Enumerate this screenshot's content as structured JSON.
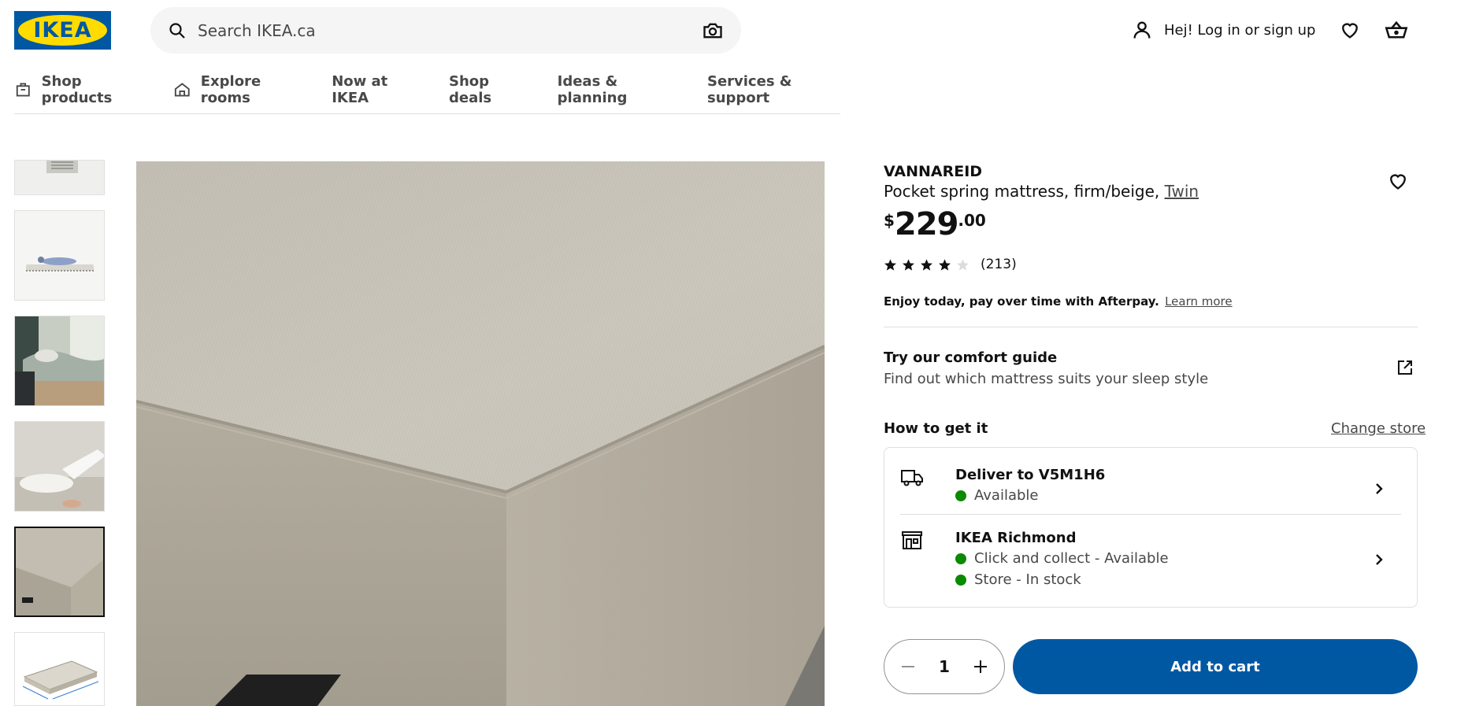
{
  "header": {
    "logo_text": "IKEA",
    "search_placeholder": "Search IKEA.ca",
    "login_label": "Hej! Log in or sign up"
  },
  "nav": {
    "items": [
      {
        "label": "Shop products",
        "icon": "store-bag-icon"
      },
      {
        "label": "Explore rooms",
        "icon": "house-icon"
      },
      {
        "label": "Now at IKEA"
      },
      {
        "label": "Shop deals"
      },
      {
        "label": "Ideas & planning"
      },
      {
        "label": "Services & support"
      }
    ]
  },
  "gallery": {
    "thumbnail_count": 6,
    "active_index": 4
  },
  "product": {
    "name": "VANNAREID",
    "description": "Pocket spring mattress, firm/beige,",
    "size_link": "Twin",
    "price_currency": "$",
    "price_integer": "229",
    "price_decimal": ".00",
    "rating_value": 4,
    "rating_max": 5,
    "review_count": "(213)",
    "afterpay_text": "Enjoy today, pay over time with Afterpay.",
    "afterpay_link": "Learn more"
  },
  "comfort": {
    "title": "Try our comfort guide",
    "subtitle": "Find out which mattress suits your sleep style"
  },
  "availability": {
    "heading": "How to get it",
    "change_store": "Change store",
    "delivery": {
      "title": "Deliver to V5M1H6",
      "status": "Available"
    },
    "store": {
      "title": "IKEA Richmond",
      "status_1": "Click and collect - Available",
      "status_2": "Store - In stock"
    }
  },
  "cart": {
    "quantity": "1",
    "add_label": "Add to cart"
  },
  "colors": {
    "ikea_blue": "#0058a3",
    "ikea_yellow": "#ffdb00",
    "available_green": "#0a8a00"
  }
}
